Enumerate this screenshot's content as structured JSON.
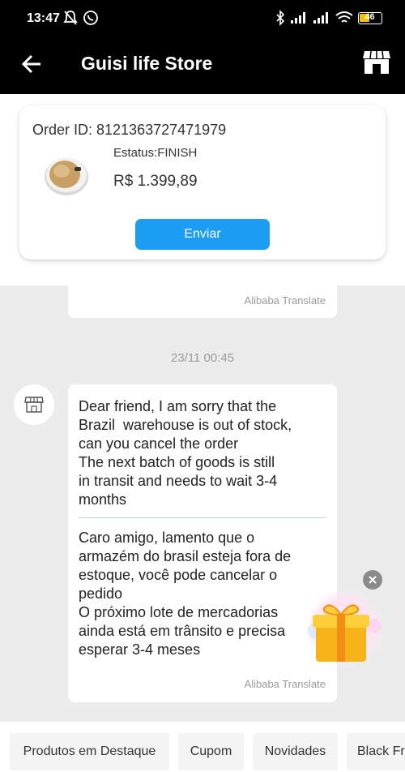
{
  "status_bar": {
    "time": "13:47",
    "battery": "46"
  },
  "header": {
    "title": "Guisi life Store"
  },
  "order": {
    "id_text": "Order ID: 8121363727471979",
    "status": "Estatus:FINISH",
    "price": "R$ 1.399,89",
    "send_label": "Enviar"
  },
  "previous_message": {
    "translate_label": "Alibaba Translate"
  },
  "conversation": {
    "timestamp": "23/11 00:45"
  },
  "message": {
    "original": "Dear friend, I am sorry that the\nBrazil  warehouse is out of stock,\ncan you cancel the order\nThe next batch of goods is still\nin transit and needs to wait 3-4\nmonths",
    "translated": "Caro amigo, lamento que o\narmazém do brasil esteja fora de\nestoque, você pode cancelar o\npedido\nO próximo lote de mercadorias\nainda está em trânsito e precisa\nesperar 3-4 meses",
    "translate_label": "Alibaba Translate"
  },
  "quick_actions": [
    {
      "label": "Produtos em Destaque"
    },
    {
      "label": "Cupom"
    },
    {
      "label": "Novidades"
    },
    {
      "label": "Black Fr"
    }
  ],
  "colors": {
    "accent": "#1a9df3",
    "header_bg": "#000000",
    "chat_bg": "#ececec"
  },
  "icons": {
    "back": "arrow-left-icon",
    "store": "store-icon",
    "avatar": "shop-avatar-icon",
    "gift": "gift-icon",
    "close": "close-icon"
  }
}
